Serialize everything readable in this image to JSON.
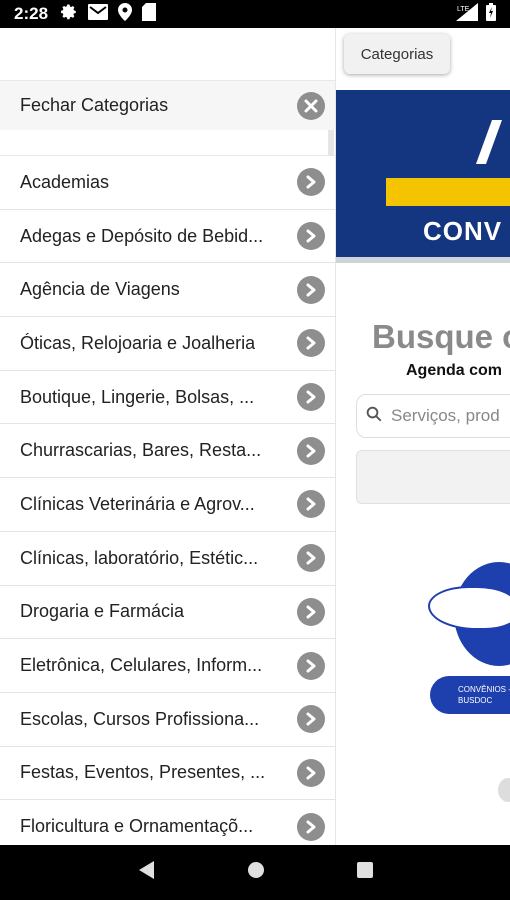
{
  "status_bar": {
    "time": "2:28",
    "icons": [
      "gear-icon",
      "mail-icon",
      "location-icon",
      "sd-card-icon"
    ],
    "network": "LTE",
    "right_icons": [
      "signal-icon",
      "battery-icon"
    ]
  },
  "background_app": {
    "categorias_button": "Categorias",
    "banner_text": "CONV",
    "headline": "Busque o",
    "subheadline": "Agenda com",
    "search_placeholder": "Serviços, prod",
    "logo_pill_text_1": "CONVÊNIOS - T",
    "logo_pill_text_2": "BUSDOC"
  },
  "drawer": {
    "close_label": "Fechar Categorias",
    "items": [
      {
        "label": "Academias"
      },
      {
        "label": "Adegas e Depósito de Bebid..."
      },
      {
        "label": "Agência de Viagens"
      },
      {
        "label": "Óticas, Relojoaria e Joalheria"
      },
      {
        "label": "Boutique, Lingerie, Bolsas, ..."
      },
      {
        "label": "Churrascarias, Bares, Resta..."
      },
      {
        "label": "Clínicas Veterinária e Agrov..."
      },
      {
        "label": "Clínicas, laboratório, Estétic..."
      },
      {
        "label": "Drogaria e Farmácia"
      },
      {
        "label": "Eletrônica, Celulares, Inform..."
      },
      {
        "label": "Escolas, Cursos Profissiona..."
      },
      {
        "label": "Festas, Eventos, Presentes, ..."
      },
      {
        "label": "Floricultura e Ornamentaçõ..."
      }
    ]
  },
  "nav_bar": {
    "buttons": [
      "back-icon",
      "home-icon",
      "recents-icon"
    ]
  },
  "colors": {
    "banner_blue": "#14357f",
    "banner_yellow": "#f5c400",
    "icon_gray": "#8e8e8e"
  }
}
